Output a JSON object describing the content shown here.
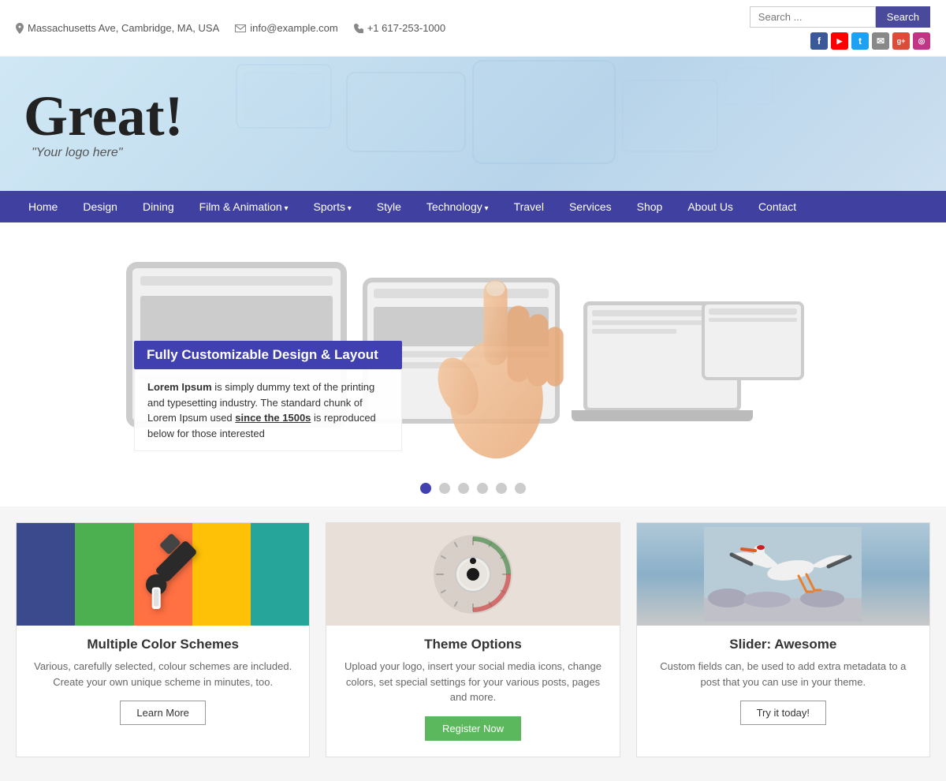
{
  "topbar": {
    "address": "Massachusetts Ave, Cambridge, MA, USA",
    "email": "info@example.com",
    "phone": "+1 617-253-1000",
    "search_placeholder": "Search ...",
    "search_button": "Search"
  },
  "social": [
    {
      "name": "facebook",
      "label": "f",
      "class": "social-fb"
    },
    {
      "name": "youtube",
      "label": "▶",
      "class": "social-yt"
    },
    {
      "name": "twitter",
      "label": "t",
      "class": "social-tw"
    },
    {
      "name": "email",
      "label": "✉",
      "class": "social-em"
    },
    {
      "name": "google-plus",
      "label": "g+",
      "class": "social-gp"
    },
    {
      "name": "instagram",
      "label": "📷",
      "class": "social-ig"
    }
  ],
  "logo": {
    "title": "Great!",
    "subtitle": "\"Your logo here\""
  },
  "nav": {
    "items": [
      {
        "label": "Home",
        "dropdown": false
      },
      {
        "label": "Design",
        "dropdown": false
      },
      {
        "label": "Dining",
        "dropdown": false
      },
      {
        "label": "Film & Animation",
        "dropdown": true
      },
      {
        "label": "Sports",
        "dropdown": true
      },
      {
        "label": "Style",
        "dropdown": false
      },
      {
        "label": "Technology",
        "dropdown": true
      },
      {
        "label": "Travel",
        "dropdown": false
      },
      {
        "label": "Services",
        "dropdown": false
      },
      {
        "label": "Shop",
        "dropdown": false
      },
      {
        "label": "About Us",
        "dropdown": false
      },
      {
        "label": "Contact",
        "dropdown": false
      }
    ]
  },
  "slider": {
    "title": "Fully Customizable Design & Layout",
    "desc_bold": "Lorem Ipsum",
    "desc_text": " is simply dummy text of the printing and typesetting industry. The standard chunk of Lorem Ipsum used ",
    "desc_link": "since the 1500s",
    "desc_end": " is reproduced below for those interested",
    "dots": [
      {
        "active": true
      },
      {
        "active": false
      },
      {
        "active": false
      },
      {
        "active": false
      },
      {
        "active": false
      },
      {
        "active": false
      }
    ]
  },
  "features": [
    {
      "title": "Multiple Color Schemes",
      "desc": "Various, carefully selected, colour schemes are included. Create your own unique scheme in minutes, too.",
      "button": "Learn More",
      "button_type": "outline"
    },
    {
      "title": "Theme Options",
      "desc": "Upload your logo, insert your social media icons, change colors, set special settings for your various posts, pages and more.",
      "button": "Register Now",
      "button_type": "green"
    },
    {
      "title": "Slider: Awesome",
      "desc": "Custom fields can, be used to add extra metadata to a post that you can use in your theme.",
      "button": "Try it today!",
      "button_type": "outline"
    }
  ]
}
